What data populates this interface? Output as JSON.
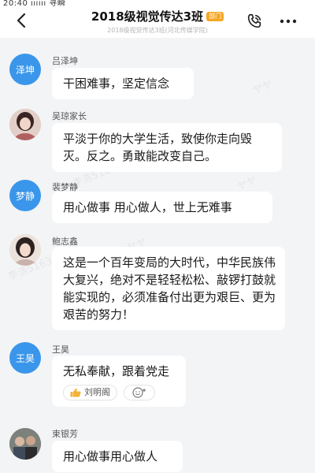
{
  "status_bar": {
    "text": "20:40 ıııııı 寻瞬"
  },
  "header": {
    "title": "2018级视觉传达3班",
    "badge": "部门",
    "subtitle": "2018级视觉传达3班(河北传媒学院)"
  },
  "messages": [
    {
      "sender": "吕泽坤",
      "avatar_text": "泽坤",
      "text": "干困难事，坚定信念"
    },
    {
      "sender": "吴琼家长",
      "avatar_text": "",
      "text": "平淡于你的大学生活，致使你走向毁灭。反之。勇敢能改变自己。"
    },
    {
      "sender": "裴梦静",
      "avatar_text": "梦静",
      "text": "用心做事 用心做人，世上无难事"
    },
    {
      "sender": "鲍志鑫",
      "avatar_text": "",
      "text": "这是一个百年变局的大时代，中华民族伟大复兴，绝对不是轻轻松松、敲锣打鼓就能实现的，必须准备付出更为艰巨、更为艰苦的努力！"
    },
    {
      "sender": "王昊",
      "avatar_text": "王昊",
      "text": "无私奉献，跟着党走",
      "reaction_name": "刘明阁"
    },
    {
      "sender": "束银芳",
      "avatar_text": "",
      "text": "用心做事用心做人"
    }
  ],
  "watermarks": [
    "李浩5163",
    "ヤヤ"
  ]
}
